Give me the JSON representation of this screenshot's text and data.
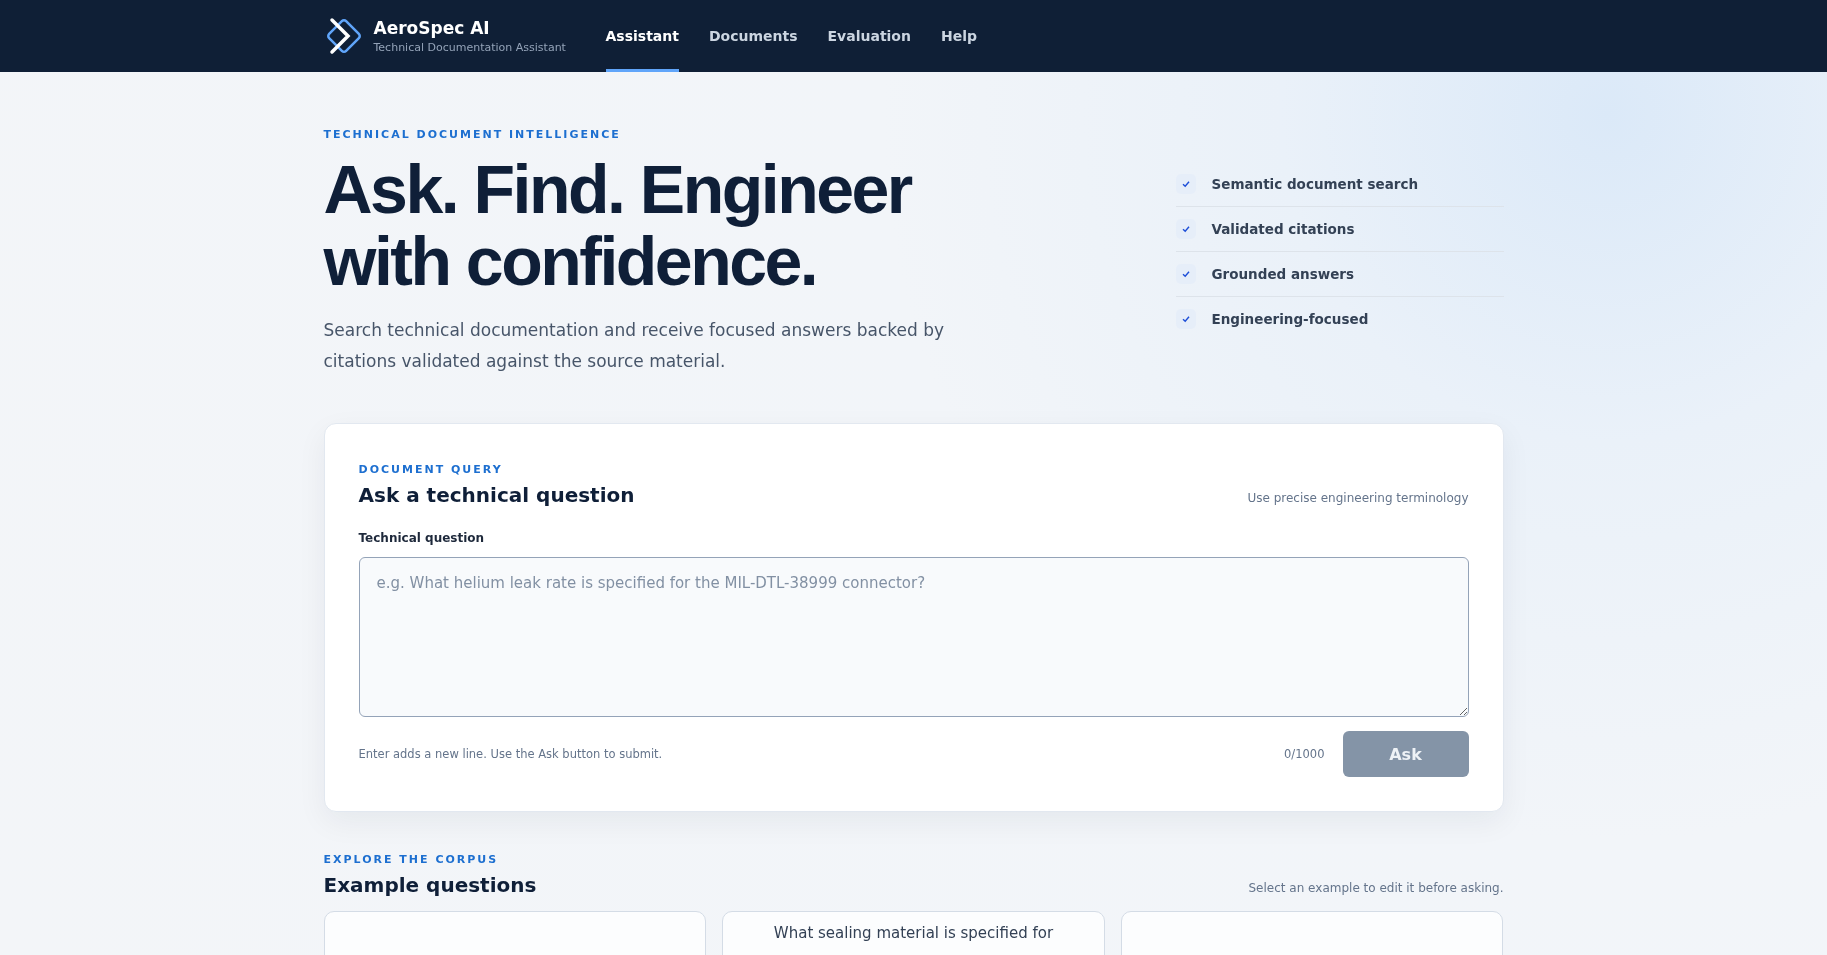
{
  "brand": {
    "name": "AeroSpec AI",
    "tagline": "Technical Documentation Assistant"
  },
  "nav": [
    {
      "label": "Assistant",
      "selected": true
    },
    {
      "label": "Documents",
      "selected": false
    },
    {
      "label": "Evaluation",
      "selected": false
    },
    {
      "label": "Help",
      "selected": false
    }
  ],
  "hero": {
    "eyebrow": "TECHNICAL DOCUMENT INTELLIGENCE",
    "title": "Ask. Find. Engineer with confidence.",
    "lead": "Search technical documentation and receive focused answers backed by citations validated against the source material."
  },
  "features": [
    {
      "label": "Semantic document search",
      "checked": true
    },
    {
      "label": "Validated citations",
      "checked": true
    },
    {
      "label": "Grounded answers",
      "checked": true
    },
    {
      "label": "Engineering-focused",
      "checked": true
    }
  ],
  "query": {
    "eyebrow": "DOCUMENT QUERY",
    "title": "Ask a technical question",
    "hint": "Use precise engineering terminology",
    "field_label": "Technical question",
    "placeholder": "e.g. What helium leak rate is specified for the MIL-DTL-38999 connector?",
    "help": "Enter adds a new line. Use the Ask button to submit.",
    "counter": "0/1000",
    "submit": {
      "label": "Ask",
      "disabled": true
    }
  },
  "examples": {
    "eyebrow": "EXPLORE THE CORPUS",
    "title": "Example questions",
    "hint": "Select an example to edit it before asking.",
    "cards": [
      {
        "kind": "question"
      },
      {
        "kind": "question",
        "text": "What sealing material is specified for"
      },
      {
        "kind": "question"
      }
    ]
  }
}
